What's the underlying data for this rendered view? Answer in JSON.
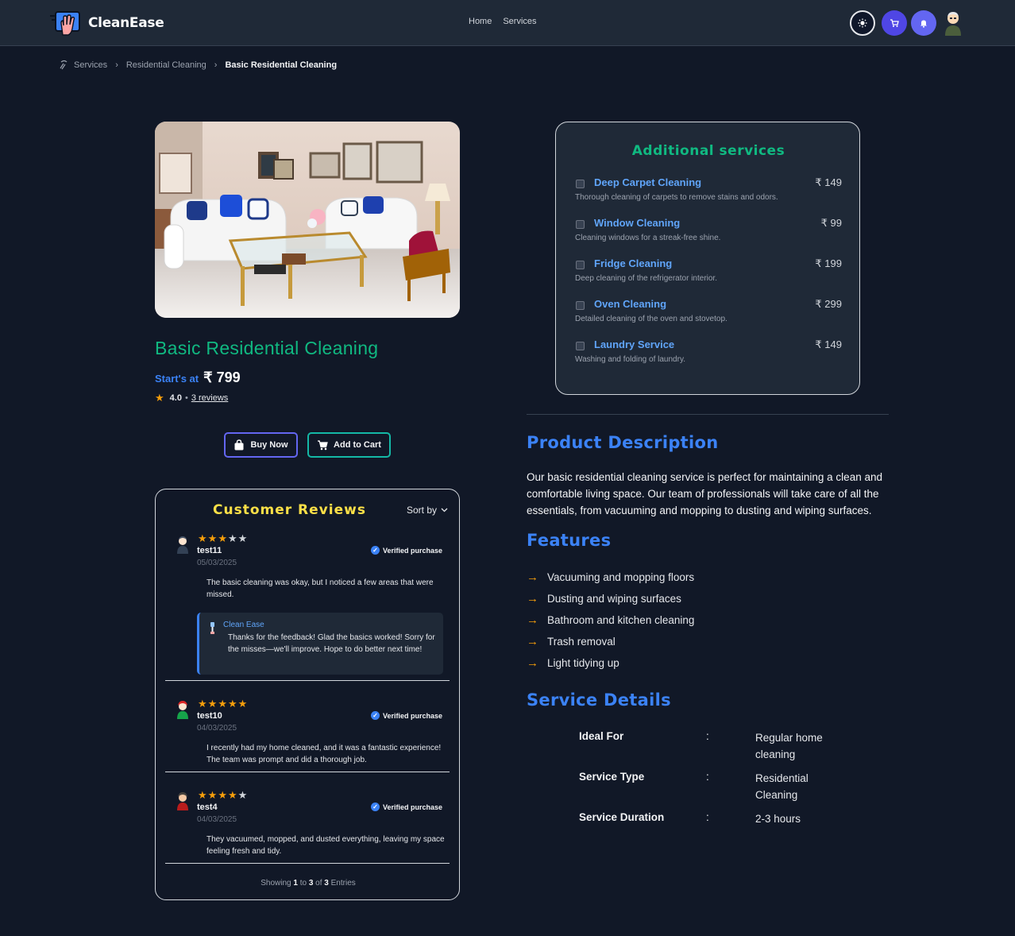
{
  "header": {
    "brand": "CleanEase",
    "nav": [
      "Home",
      "Services"
    ]
  },
  "breadcrumb": {
    "items": [
      "Services",
      "Residential Cleaning"
    ],
    "current": "Basic Residential Cleaning"
  },
  "product": {
    "title": "Basic Residential Cleaning",
    "price_label": "Start's at",
    "price": "₹ 799",
    "rating": "4.0",
    "reviews_link": "3 reviews",
    "buy_now": "Buy Now",
    "add_to_cart": "Add to Cart"
  },
  "reviews": {
    "title": "Customer Reviews",
    "sort_label": "Sort by",
    "verified_label": "Verified purchase",
    "items": [
      {
        "name": "test11",
        "date": "05/03/2025",
        "stars": 3,
        "text": "The basic cleaning was okay, but I noticed a few areas that were missed.",
        "reply_author": "Clean Ease",
        "reply_text": "Thanks for the feedback! Glad the basics worked! Sorry for the misses—we'll improve. Hope to do better next time!"
      },
      {
        "name": "test10",
        "date": "04/03/2025",
        "stars": 5,
        "text": "I recently had my home cleaned, and it was a fantastic experience! The team was prompt and did a thorough job."
      },
      {
        "name": "test4",
        "date": "04/03/2025",
        "stars": 4,
        "text": "They vacuumed, mopped, and dusted everything, leaving my space feeling fresh and tidy."
      }
    ],
    "showing_prefix": "Showing",
    "showing_from": "1",
    "showing_to_word": "to",
    "showing_to": "3",
    "showing_of_word": "of",
    "showing_total": "3",
    "showing_suffix": "Entries"
  },
  "additional_services": {
    "title": "Additional services",
    "items": [
      {
        "name": "Deep Carpet Cleaning",
        "price": "₹ 149",
        "desc": "Thorough cleaning of carpets to remove stains and odors."
      },
      {
        "name": "Window Cleaning",
        "price": "₹ 99",
        "desc": "Cleaning windows for a streak-free shine."
      },
      {
        "name": "Fridge Cleaning",
        "price": "₹ 199",
        "desc": "Deep cleaning of the refrigerator interior."
      },
      {
        "name": "Oven Cleaning",
        "price": "₹ 299",
        "desc": "Detailed cleaning of the oven and stovetop."
      },
      {
        "name": "Laundry Service",
        "price": "₹ 149",
        "desc": "Washing and folding of laundry."
      }
    ]
  },
  "description": {
    "heading": "Product Description",
    "text": "Our basic residential cleaning service is perfect for maintaining a clean and comfortable living space. Our team of professionals will take care of all the essentials, from vacuuming and mopping to dusting and wiping surfaces."
  },
  "features": {
    "heading": "Features",
    "items": [
      "Vacuuming and mopping floors",
      "Dusting and wiping surfaces",
      "Bathroom and kitchen cleaning",
      "Trash removal",
      "Light tidying up"
    ]
  },
  "service_details": {
    "heading": "Service Details",
    "separator": ":",
    "rows": [
      {
        "key": "Ideal For",
        "value": "Regular home cleaning"
      },
      {
        "key": "Service Type",
        "value": "Residential Cleaning"
      },
      {
        "key": "Service Duration",
        "value": "2-3 hours"
      }
    ]
  },
  "colors": {
    "background": "#111827",
    "panel": "#1f2937",
    "accent_green": "#10b981",
    "accent_blue": "#3b82f6",
    "star": "#f59e0b",
    "reviews_title": "#fde047"
  }
}
